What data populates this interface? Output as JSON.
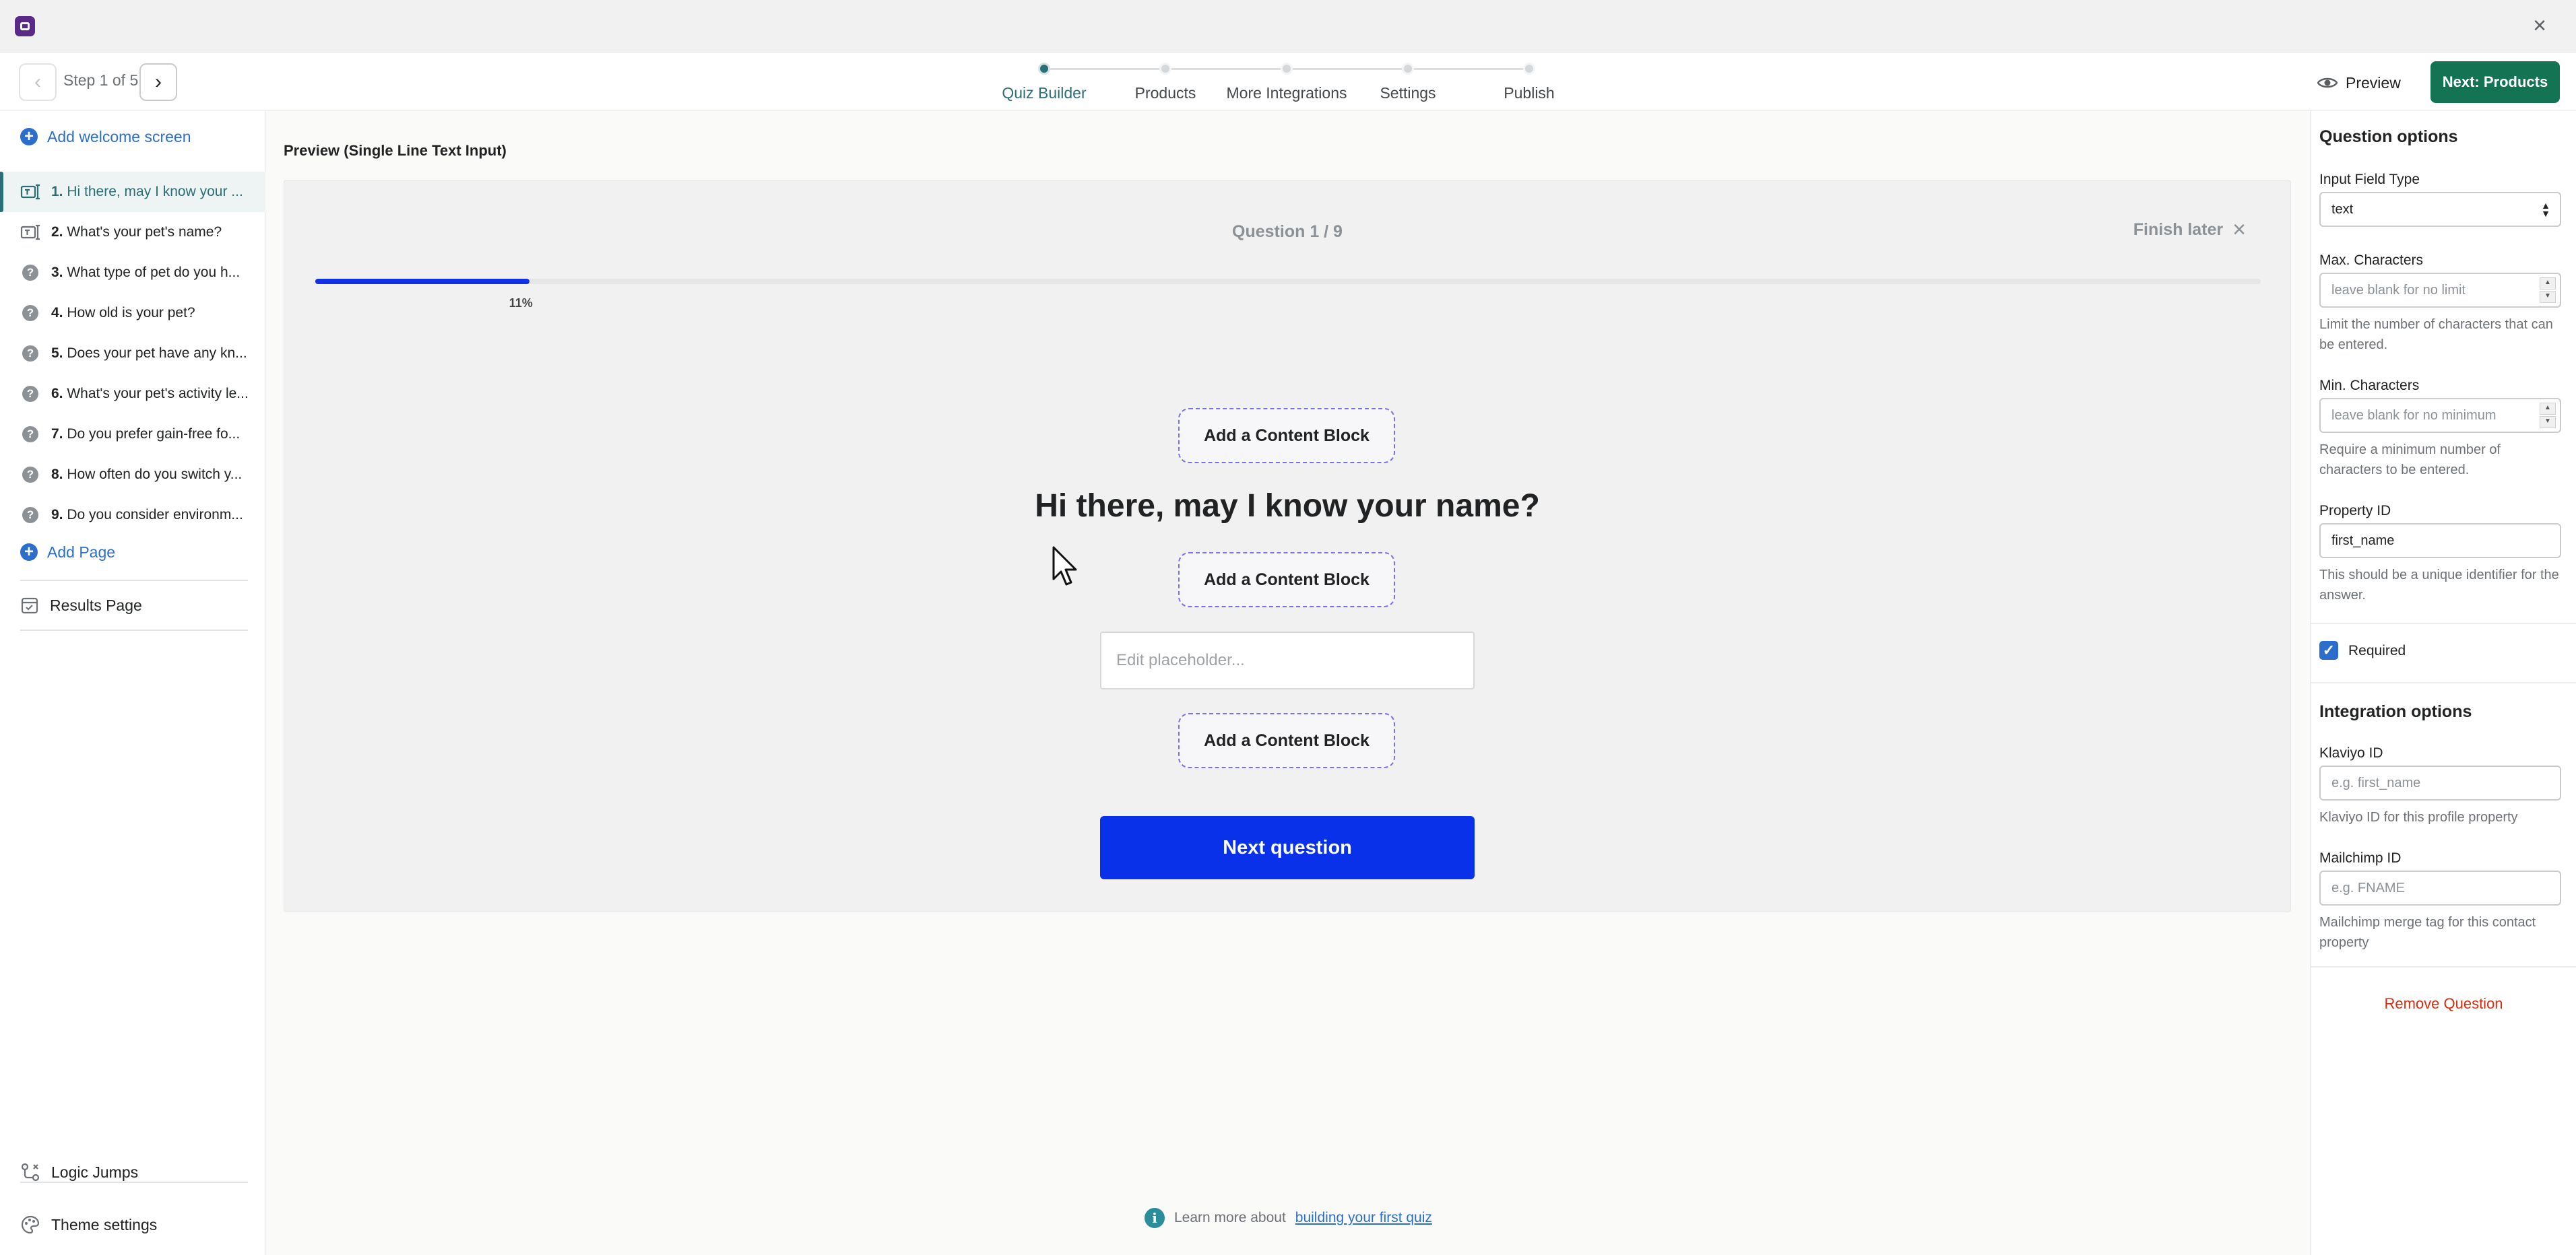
{
  "window": {
    "app_icon": "app-logo-icon",
    "close_icon": "close-icon"
  },
  "topbar": {
    "step_label": "Step 1 of 5",
    "steps": [
      {
        "label": "Quiz Builder",
        "active": true
      },
      {
        "label": "Products",
        "active": false
      },
      {
        "label": "More Integrations",
        "active": false
      },
      {
        "label": "Settings",
        "active": false
      },
      {
        "label": "Publish",
        "active": false
      }
    ],
    "preview_label": "Preview",
    "next_label": "Next: Products"
  },
  "sidebar": {
    "add_welcome": "Add welcome screen",
    "questions": [
      {
        "num": "1.",
        "text": "Hi there, may I know your ...",
        "icon": "text-input-icon",
        "active": true
      },
      {
        "num": "2.",
        "text": "What's your pet's name?",
        "icon": "text-input-icon",
        "active": false
      },
      {
        "num": "3.",
        "text": "What type of pet do you h...",
        "icon": "question-icon",
        "active": false
      },
      {
        "num": "4.",
        "text": "How old is your pet?",
        "icon": "question-icon",
        "active": false
      },
      {
        "num": "5.",
        "text": "Does your pet have any kn...",
        "icon": "question-icon",
        "active": false
      },
      {
        "num": "6.",
        "text": "What's your pet's activity le...",
        "icon": "question-icon",
        "active": false
      },
      {
        "num": "7.",
        "text": "Do you prefer gain-free fo...",
        "icon": "question-icon",
        "active": false
      },
      {
        "num": "8.",
        "text": "How often do you switch y...",
        "icon": "question-icon",
        "active": false
      },
      {
        "num": "9.",
        "text": "Do you consider environm...",
        "icon": "question-icon",
        "active": false
      }
    ],
    "add_page": "Add Page",
    "results_page": "Results Page",
    "logic_jumps": "Logic Jumps",
    "theme_settings": "Theme settings"
  },
  "main": {
    "preview_title": "Preview (Single Line Text Input)",
    "question_counter": "Question 1 / 9",
    "finish_later": "Finish later",
    "progress_percent": 11,
    "progress_label": "11%",
    "content_block_label": "Add a Content Block",
    "question_heading": "Hi there, may I know your name?",
    "input_placeholder": "Edit placeholder...",
    "next_question": "Next question",
    "learn_more_prefix": "Learn more about",
    "learn_more_link": "building your first quiz"
  },
  "right_panel": {
    "question_options_title": "Question options",
    "input_field_type_label": "Input Field Type",
    "input_field_type_value": "text",
    "max_chars_label": "Max. Characters",
    "max_chars_placeholder": "leave blank for no limit",
    "max_chars_help": "Limit the number of characters that can be entered.",
    "min_chars_label": "Min. Characters",
    "min_chars_placeholder": "leave blank for no minimum",
    "min_chars_help": "Require a minimum number of characters to be entered.",
    "property_id_label": "Property ID",
    "property_id_value": "first_name",
    "property_id_help": "This should be a unique identifier for the answer.",
    "required_label": "Required",
    "required_checked": true,
    "integration_title": "Integration options",
    "klaviyo_label": "Klaviyo ID",
    "klaviyo_placeholder": "e.g. first_name",
    "klaviyo_help": "Klaviyo ID for this profile property",
    "mailchimp_label": "Mailchimp ID",
    "mailchimp_placeholder": "e.g. FNAME",
    "mailchimp_help": "Mailchimp merge tag for this contact property",
    "remove_question": "Remove Question"
  },
  "colors": {
    "brand_teal": "#2c6e75",
    "primary_green": "#137353",
    "next_question_blue": "#0831e9",
    "progress_blue": "#1230e6",
    "link_blue": "#2c6ecb",
    "danger_red": "#d82c0d"
  }
}
